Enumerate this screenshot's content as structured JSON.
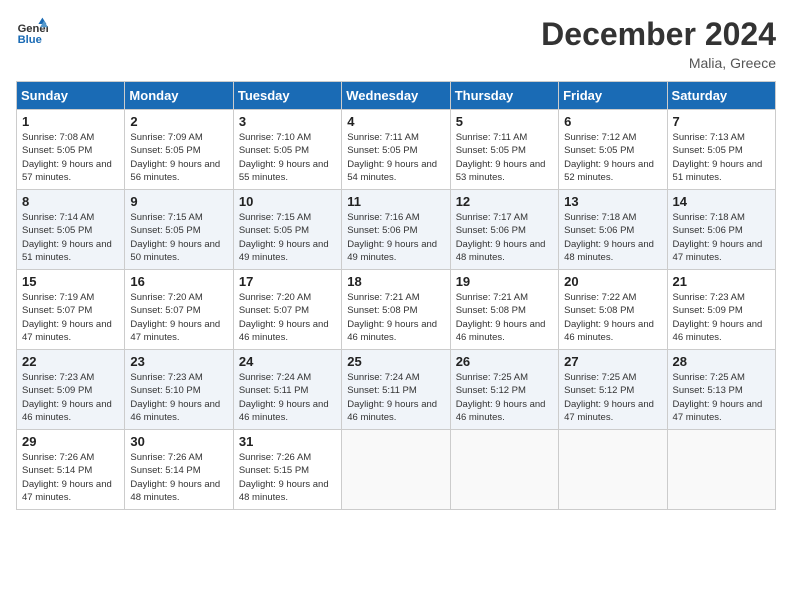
{
  "header": {
    "logo_line1": "General",
    "logo_line2": "Blue",
    "month": "December 2024",
    "location": "Malia, Greece"
  },
  "weekdays": [
    "Sunday",
    "Monday",
    "Tuesday",
    "Wednesday",
    "Thursday",
    "Friday",
    "Saturday"
  ],
  "weeks": [
    [
      {
        "day": "1",
        "sunrise": "Sunrise: 7:08 AM",
        "sunset": "Sunset: 5:05 PM",
        "daylight": "Daylight: 9 hours and 57 minutes."
      },
      {
        "day": "2",
        "sunrise": "Sunrise: 7:09 AM",
        "sunset": "Sunset: 5:05 PM",
        "daylight": "Daylight: 9 hours and 56 minutes."
      },
      {
        "day": "3",
        "sunrise": "Sunrise: 7:10 AM",
        "sunset": "Sunset: 5:05 PM",
        "daylight": "Daylight: 9 hours and 55 minutes."
      },
      {
        "day": "4",
        "sunrise": "Sunrise: 7:11 AM",
        "sunset": "Sunset: 5:05 PM",
        "daylight": "Daylight: 9 hours and 54 minutes."
      },
      {
        "day": "5",
        "sunrise": "Sunrise: 7:11 AM",
        "sunset": "Sunset: 5:05 PM",
        "daylight": "Daylight: 9 hours and 53 minutes."
      },
      {
        "day": "6",
        "sunrise": "Sunrise: 7:12 AM",
        "sunset": "Sunset: 5:05 PM",
        "daylight": "Daylight: 9 hours and 52 minutes."
      },
      {
        "day": "7",
        "sunrise": "Sunrise: 7:13 AM",
        "sunset": "Sunset: 5:05 PM",
        "daylight": "Daylight: 9 hours and 51 minutes."
      }
    ],
    [
      {
        "day": "8",
        "sunrise": "Sunrise: 7:14 AM",
        "sunset": "Sunset: 5:05 PM",
        "daylight": "Daylight: 9 hours and 51 minutes."
      },
      {
        "day": "9",
        "sunrise": "Sunrise: 7:15 AM",
        "sunset": "Sunset: 5:05 PM",
        "daylight": "Daylight: 9 hours and 50 minutes."
      },
      {
        "day": "10",
        "sunrise": "Sunrise: 7:15 AM",
        "sunset": "Sunset: 5:05 PM",
        "daylight": "Daylight: 9 hours and 49 minutes."
      },
      {
        "day": "11",
        "sunrise": "Sunrise: 7:16 AM",
        "sunset": "Sunset: 5:06 PM",
        "daylight": "Daylight: 9 hours and 49 minutes."
      },
      {
        "day": "12",
        "sunrise": "Sunrise: 7:17 AM",
        "sunset": "Sunset: 5:06 PM",
        "daylight": "Daylight: 9 hours and 48 minutes."
      },
      {
        "day": "13",
        "sunrise": "Sunrise: 7:18 AM",
        "sunset": "Sunset: 5:06 PM",
        "daylight": "Daylight: 9 hours and 48 minutes."
      },
      {
        "day": "14",
        "sunrise": "Sunrise: 7:18 AM",
        "sunset": "Sunset: 5:06 PM",
        "daylight": "Daylight: 9 hours and 47 minutes."
      }
    ],
    [
      {
        "day": "15",
        "sunrise": "Sunrise: 7:19 AM",
        "sunset": "Sunset: 5:07 PM",
        "daylight": "Daylight: 9 hours and 47 minutes."
      },
      {
        "day": "16",
        "sunrise": "Sunrise: 7:20 AM",
        "sunset": "Sunset: 5:07 PM",
        "daylight": "Daylight: 9 hours and 47 minutes."
      },
      {
        "day": "17",
        "sunrise": "Sunrise: 7:20 AM",
        "sunset": "Sunset: 5:07 PM",
        "daylight": "Daylight: 9 hours and 46 minutes."
      },
      {
        "day": "18",
        "sunrise": "Sunrise: 7:21 AM",
        "sunset": "Sunset: 5:08 PM",
        "daylight": "Daylight: 9 hours and 46 minutes."
      },
      {
        "day": "19",
        "sunrise": "Sunrise: 7:21 AM",
        "sunset": "Sunset: 5:08 PM",
        "daylight": "Daylight: 9 hours and 46 minutes."
      },
      {
        "day": "20",
        "sunrise": "Sunrise: 7:22 AM",
        "sunset": "Sunset: 5:08 PM",
        "daylight": "Daylight: 9 hours and 46 minutes."
      },
      {
        "day": "21",
        "sunrise": "Sunrise: 7:23 AM",
        "sunset": "Sunset: 5:09 PM",
        "daylight": "Daylight: 9 hours and 46 minutes."
      }
    ],
    [
      {
        "day": "22",
        "sunrise": "Sunrise: 7:23 AM",
        "sunset": "Sunset: 5:09 PM",
        "daylight": "Daylight: 9 hours and 46 minutes."
      },
      {
        "day": "23",
        "sunrise": "Sunrise: 7:23 AM",
        "sunset": "Sunset: 5:10 PM",
        "daylight": "Daylight: 9 hours and 46 minutes."
      },
      {
        "day": "24",
        "sunrise": "Sunrise: 7:24 AM",
        "sunset": "Sunset: 5:11 PM",
        "daylight": "Daylight: 9 hours and 46 minutes."
      },
      {
        "day": "25",
        "sunrise": "Sunrise: 7:24 AM",
        "sunset": "Sunset: 5:11 PM",
        "daylight": "Daylight: 9 hours and 46 minutes."
      },
      {
        "day": "26",
        "sunrise": "Sunrise: 7:25 AM",
        "sunset": "Sunset: 5:12 PM",
        "daylight": "Daylight: 9 hours and 46 minutes."
      },
      {
        "day": "27",
        "sunrise": "Sunrise: 7:25 AM",
        "sunset": "Sunset: 5:12 PM",
        "daylight": "Daylight: 9 hours and 47 minutes."
      },
      {
        "day": "28",
        "sunrise": "Sunrise: 7:25 AM",
        "sunset": "Sunset: 5:13 PM",
        "daylight": "Daylight: 9 hours and 47 minutes."
      }
    ],
    [
      {
        "day": "29",
        "sunrise": "Sunrise: 7:26 AM",
        "sunset": "Sunset: 5:14 PM",
        "daylight": "Daylight: 9 hours and 47 minutes."
      },
      {
        "day": "30",
        "sunrise": "Sunrise: 7:26 AM",
        "sunset": "Sunset: 5:14 PM",
        "daylight": "Daylight: 9 hours and 48 minutes."
      },
      {
        "day": "31",
        "sunrise": "Sunrise: 7:26 AM",
        "sunset": "Sunset: 5:15 PM",
        "daylight": "Daylight: 9 hours and 48 minutes."
      },
      null,
      null,
      null,
      null
    ]
  ]
}
